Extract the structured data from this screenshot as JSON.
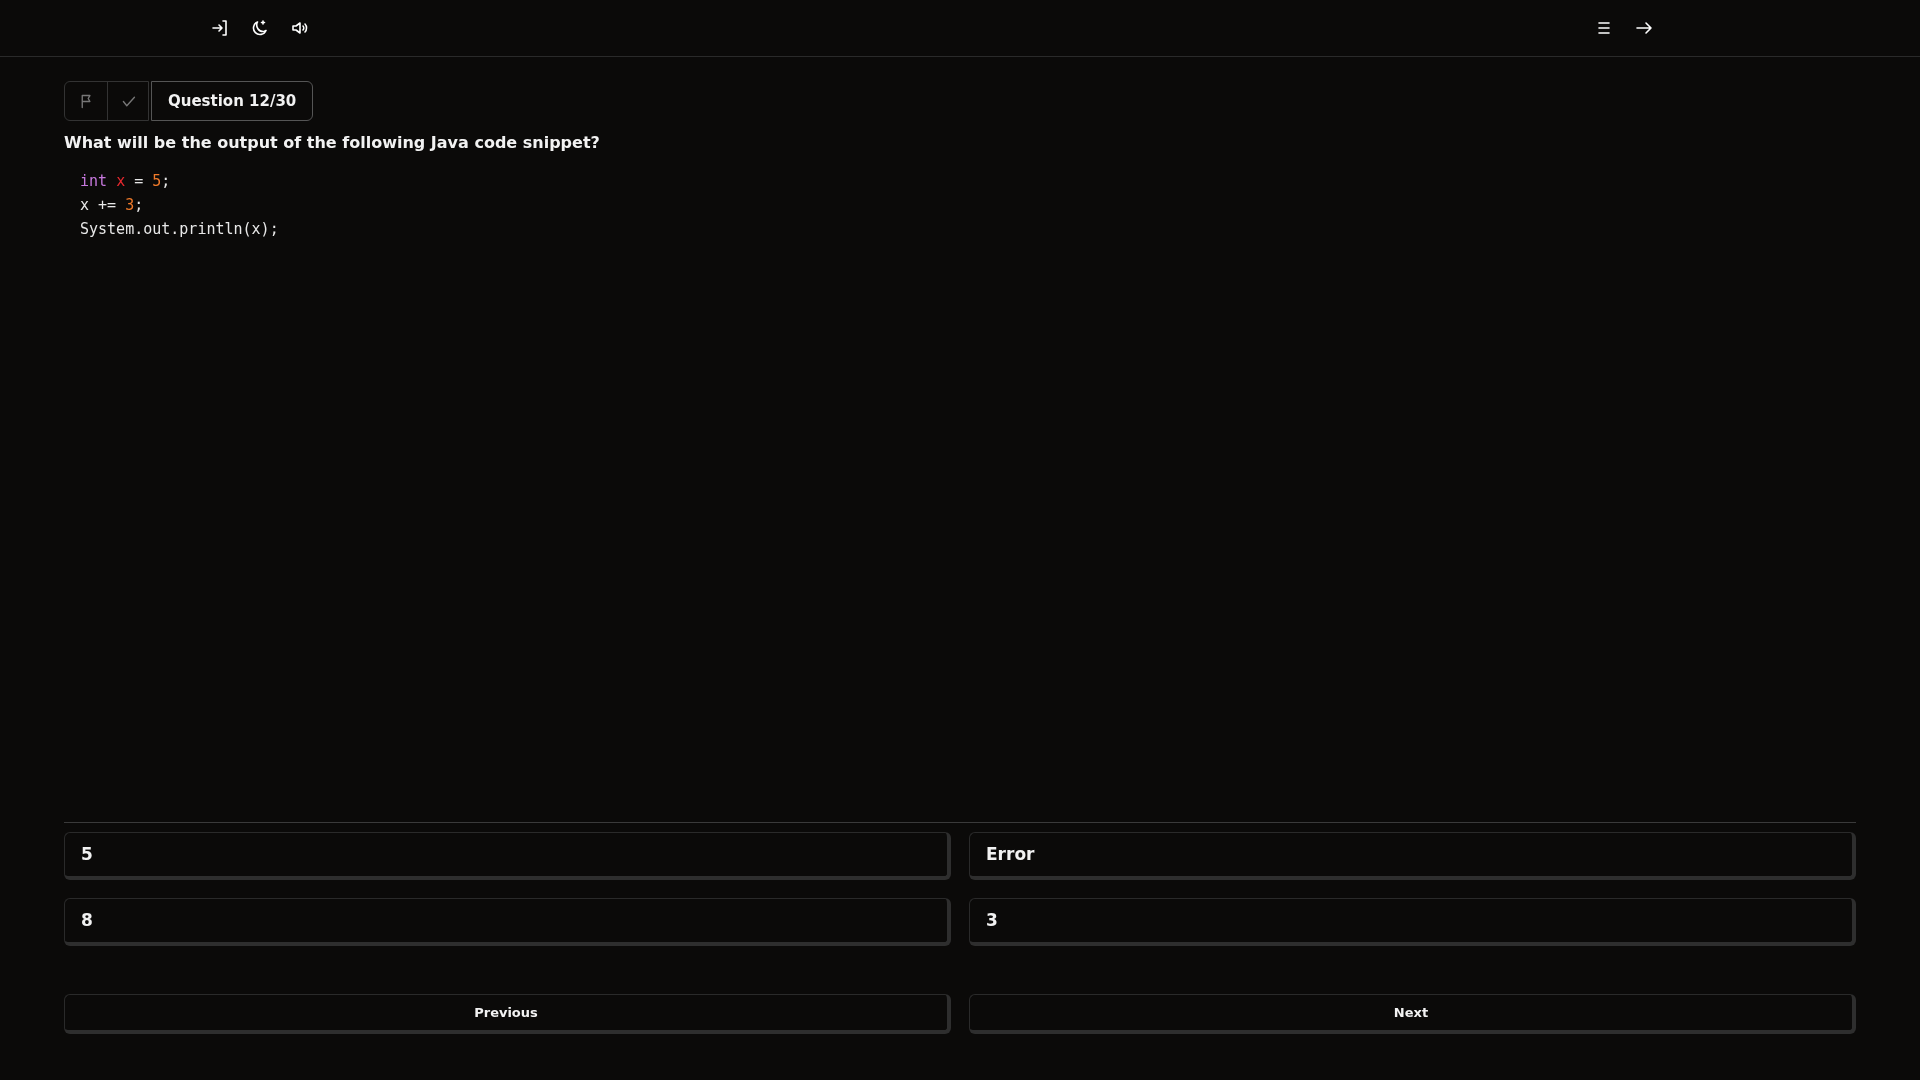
{
  "top_bar": {
    "left_icons": [
      {
        "kind": "sign-in"
      },
      {
        "kind": "theme"
      },
      {
        "kind": "sound"
      }
    ],
    "right_icons": [
      {
        "kind": "menu"
      },
      {
        "kind": "forward"
      }
    ]
  },
  "question_header": {
    "flag_icon": {
      "kind": "flag"
    },
    "check_icon": {
      "kind": "check"
    },
    "label": "Question 12/30"
  },
  "question": "What will be the output of the following Java code snippet?",
  "code_lines": [
    [
      {
        "kind": "keyword",
        "text": "int "
      },
      {
        "kind": "variable",
        "text": "x"
      },
      {
        "kind": "plain",
        "text": " = "
      },
      {
        "kind": "number",
        "text": "5"
      },
      {
        "kind": "plain",
        "text": ";"
      }
    ],
    [
      {
        "kind": "plain",
        "text": "x += "
      },
      {
        "kind": "number",
        "text": "3"
      },
      {
        "kind": "plain",
        "text": ";"
      }
    ],
    [
      {
        "kind": "plain",
        "text": "System.out.println(x);"
      }
    ]
  ],
  "options": [
    {
      "label": "5",
      "selected": false
    },
    {
      "label": "Error",
      "selected": false
    },
    {
      "label": "8",
      "selected": false
    },
    {
      "label": "3",
      "selected": false
    }
  ],
  "nav_buttons": [
    "Previous",
    "Next"
  ]
}
